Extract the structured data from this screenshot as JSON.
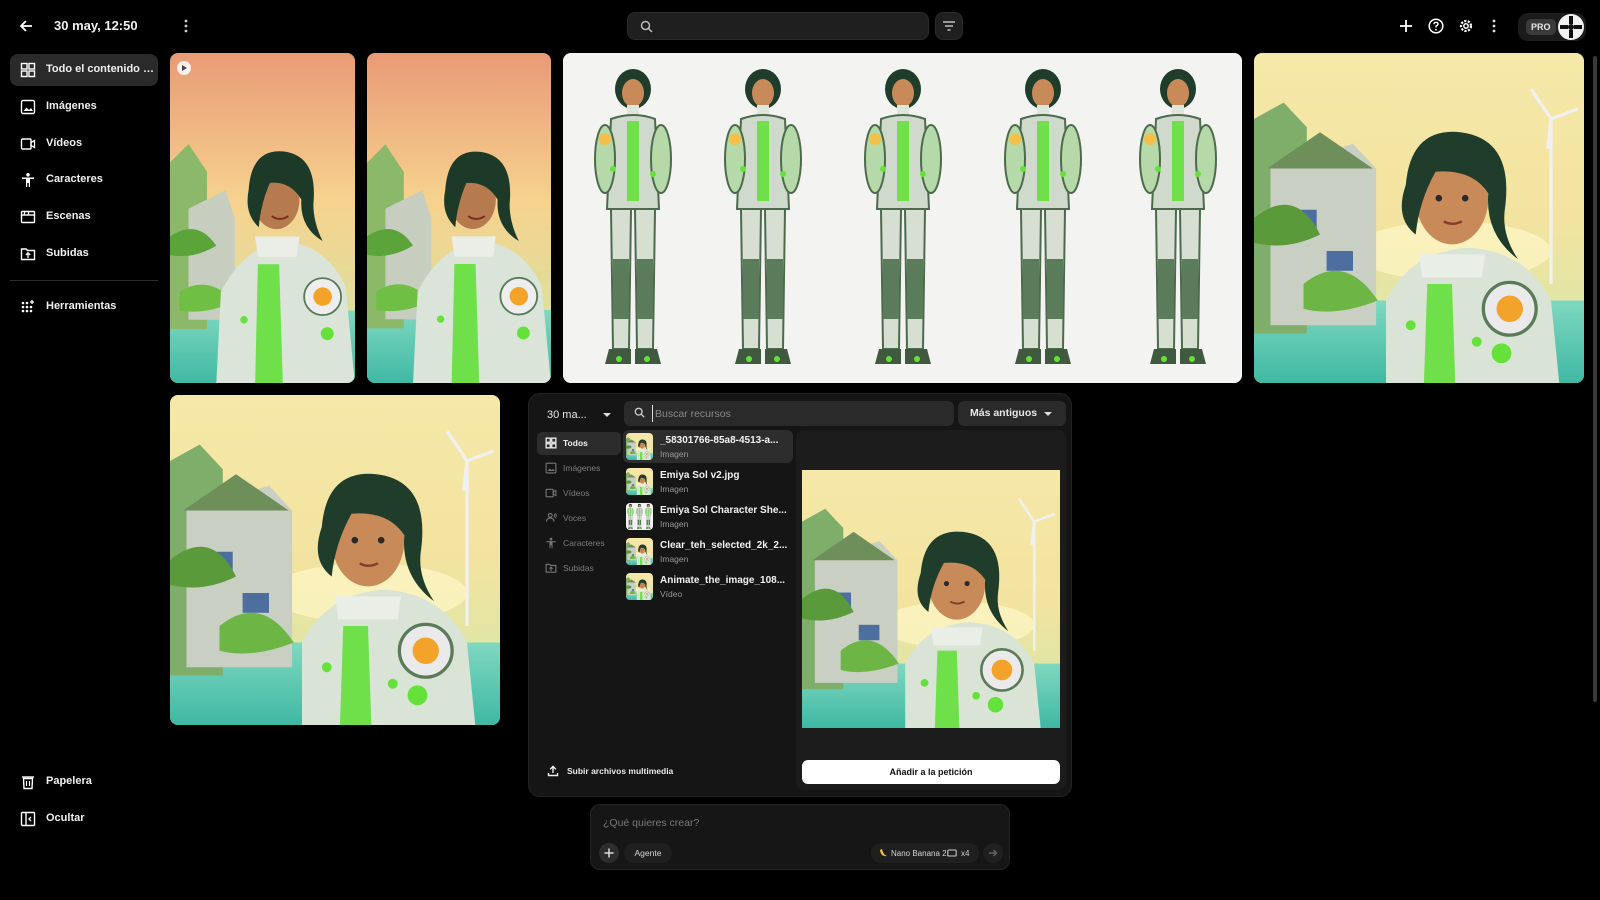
{
  "header": {
    "title": "30 may, 12:50",
    "pro_label": "PRO"
  },
  "sidebar": {
    "items": [
      {
        "label": "Todo el contenido mul...",
        "icon": "grid-icon"
      },
      {
        "label": "Imágenes",
        "icon": "image-icon"
      },
      {
        "label": "Vídeos",
        "icon": "video-icon"
      },
      {
        "label": "Caracteres",
        "icon": "character-icon"
      },
      {
        "label": "Escenas",
        "icon": "scene-icon"
      },
      {
        "label": "Subidas",
        "icon": "upload-folder-icon"
      }
    ],
    "tools_label": "Herramientas",
    "trash_label": "Papelera",
    "hide_label": "Ocultar"
  },
  "panel": {
    "date_filter": "30 ma...",
    "search_placeholder": "Buscar recursos",
    "sort_label": "Más antiguos",
    "categories": [
      {
        "label": "Todos",
        "active": true
      },
      {
        "label": "Imágenes"
      },
      {
        "label": "Vídeos"
      },
      {
        "label": "Voces"
      },
      {
        "label": "Caracteres"
      },
      {
        "label": "Subidas"
      }
    ],
    "resources": [
      {
        "name": "_58301766-85a8-4513-a...",
        "type": "Imagen"
      },
      {
        "name": "Emiya Sol v2.jpg",
        "type": "Imagen"
      },
      {
        "name": "Emiya Sol Character She...",
        "type": "Imagen"
      },
      {
        "name": "Clear_teh_selected_2k_2...",
        "type": "Imagen"
      },
      {
        "name": "Animate_the_image_108...",
        "type": "Vídeo"
      }
    ],
    "add_button": "Añadir a la petición",
    "upload_button": "Subir archivos multimedia"
  },
  "prompt": {
    "placeholder": "¿Qué quieres crear?",
    "agent_label": "Agente",
    "model_label": "Nano Banana 2",
    "count_label": "x4"
  },
  "colors": {
    "background": "#000000",
    "panel": "#151515",
    "accent_green": "#5fd43a",
    "sky": "#f4c98a"
  }
}
